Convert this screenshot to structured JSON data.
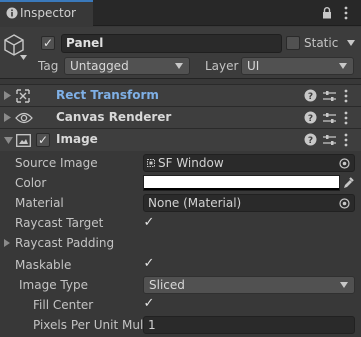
{
  "tab": {
    "label": "Inspector",
    "icon": "info-icon"
  },
  "gameobject": {
    "active": true,
    "name": "Panel",
    "static_label": "Static",
    "static_checked": false,
    "tag_label": "Tag",
    "tag_value": "Untagged",
    "layer_label": "Layer",
    "layer_value": "UI"
  },
  "components": [
    {
      "title": "Rect Transform",
      "icon": "rect-transform-icon",
      "collapsed": true,
      "title_color": "#7fb0e6"
    },
    {
      "title": "Canvas Renderer",
      "icon": "eye-icon",
      "collapsed": true
    },
    {
      "title": "Image",
      "icon": "image-icon",
      "collapsed": false,
      "enabled": true
    }
  ],
  "image": {
    "source_image_label": "Source Image",
    "source_image_value": "SF Window",
    "color_label": "Color",
    "color_value": "#ffffff",
    "material_label": "Material",
    "material_value": "None (Material)",
    "raycast_target_label": "Raycast Target",
    "raycast_target": true,
    "raycast_padding_label": "Raycast Padding",
    "maskable_label": "Maskable",
    "maskable": true,
    "image_type_label": "Image Type",
    "image_type_value": "Sliced",
    "fill_center_label": "Fill Center",
    "fill_center": true,
    "ppu_label": "Pixels Per Unit Mult",
    "ppu_value": "1"
  },
  "colors": {
    "accent_tab": "#3a79bb",
    "background": "#383838",
    "field": "#2a2a2a"
  }
}
